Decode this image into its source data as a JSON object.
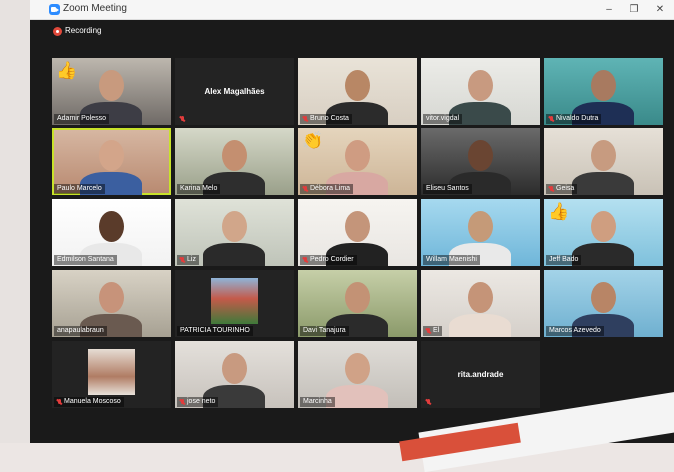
{
  "window": {
    "title": "Zoom Meeting",
    "minimize": "–",
    "maximize": "❐",
    "close": "✕"
  },
  "recording": {
    "label": "Recording",
    "icon": "record-icon"
  },
  "participants": [
    {
      "name": "Adamir Polesso",
      "muted": false,
      "video": true,
      "emoji": "👍",
      "bg": "#6f6a66",
      "wall": "#bdb7ae",
      "skin": "#c89a7e",
      "shirt": "#3d3d45"
    },
    {
      "name": "Alex Magalhães",
      "muted": true,
      "video": false
    },
    {
      "name": "Bruno Costa",
      "muted": true,
      "video": true,
      "bg": "#d8cfc2",
      "wall": "#e9e3d8",
      "skin": "#b88765",
      "shirt": "#2b2b2b"
    },
    {
      "name": "vitor.vigdal",
      "muted": false,
      "video": true,
      "bg": "#d6d7d2",
      "wall": "#ecece8",
      "skin": "#c89a80",
      "shirt": "#3a4a4a"
    },
    {
      "name": "Nivaldo Dutra",
      "muted": true,
      "video": true,
      "bg": "#3a8a8a",
      "wall": "#5fb4b5",
      "skin": "#a87a60",
      "shirt": "#1e2f55"
    },
    {
      "name": "Paulo Marcelo",
      "muted": false,
      "video": true,
      "active": true,
      "bg": "#b88970",
      "wall": "#d7b8a3",
      "skin": "#d3a58a",
      "shirt": "#3b5fa0"
    },
    {
      "name": "Karina Melo",
      "muted": false,
      "video": true,
      "bg": "#9aa08a",
      "wall": "#d5d8c8",
      "skin": "#c48f70",
      "shirt": "#2e2e2e"
    },
    {
      "name": "Débora Lima",
      "muted": true,
      "video": true,
      "emoji": "👏",
      "bg": "#cdb597",
      "wall": "#e5d5bd",
      "skin": "#cf9c82",
      "shirt": "#d8a8a2"
    },
    {
      "name": "Eliseu Santos",
      "muted": false,
      "video": true,
      "bg": "#2c2c2c",
      "wall": "#6a6a6a",
      "skin": "#6a4532",
      "shirt": "#2a2a2a"
    },
    {
      "name": "Geisa",
      "muted": true,
      "video": true,
      "bg": "#c9c2b6",
      "wall": "#e6e0d7",
      "skin": "#c79b80",
      "shirt": "#3a3a3a"
    },
    {
      "name": "Edmilson Santana",
      "muted": false,
      "video": true,
      "bg": "#f2f2f2",
      "wall": "#ffffff",
      "skin": "#5a3b2a",
      "shirt": "#e8e8e8"
    },
    {
      "name": "Liz",
      "muted": true,
      "video": true,
      "bg": "#bfc4b9",
      "wall": "#dfe2d8",
      "skin": "#d1a68a",
      "shirt": "#2a2a2a"
    },
    {
      "name": "Pedro Cordier",
      "muted": true,
      "video": true,
      "bg": "#e9e6e2",
      "wall": "#f6f4f0",
      "skin": "#c4957a",
      "shirt": "#222222"
    },
    {
      "name": "Willam Maenishi",
      "muted": false,
      "video": true,
      "bg": "#6fb6d9",
      "wall": "#a6d9ef",
      "skin": "#c59a78",
      "shirt": "#e9e9e9"
    },
    {
      "name": "Jeff Bado",
      "muted": false,
      "video": true,
      "emoji": "👍",
      "bg": "#7fc1dc",
      "wall": "#b4e0f0",
      "skin": "#cf9e80",
      "shirt": "#2a2a2a"
    },
    {
      "name": "anapaulabraun",
      "muted": false,
      "video": true,
      "bg": "#a7a193",
      "wall": "#d8d2c5",
      "skin": "#c7937a",
      "shirt": "#6a5a50"
    },
    {
      "name": "PATRICIA TOURINHO",
      "muted": false,
      "video": false,
      "photo": true
    },
    {
      "name": "Davi Tanajura",
      "muted": false,
      "video": true,
      "bg": "#8b9a6a",
      "wall": "#c6cfa8",
      "skin": "#c39275",
      "shirt": "#2b2b2b"
    },
    {
      "name": "El",
      "muted": true,
      "video": true,
      "bg": "#d5d0ca",
      "wall": "#ece8e3",
      "skin": "#c59478",
      "shirt": "#e9dcd2"
    },
    {
      "name": "Marcos Azevedo",
      "muted": false,
      "video": true,
      "bg": "#6fb0d0",
      "wall": "#a3d3e8",
      "skin": "#b88566",
      "shirt": "#2f3f5f"
    },
    {
      "name": "Manuela Moscoso",
      "muted": true,
      "video": false,
      "photo": true
    },
    {
      "name": "jose neto",
      "muted": true,
      "video": true,
      "bg": "#c7c2bc",
      "wall": "#e4e0db",
      "skin": "#c89a80",
      "shirt": "#3a3a3a"
    },
    {
      "name": "Marcinha",
      "muted": false,
      "video": true,
      "bg": "#c2beb8",
      "wall": "#e0ddd8",
      "skin": "#d0a287",
      "shirt": "#e2c1bb"
    },
    {
      "name": "rita.andrade",
      "muted": true,
      "video": false
    }
  ]
}
